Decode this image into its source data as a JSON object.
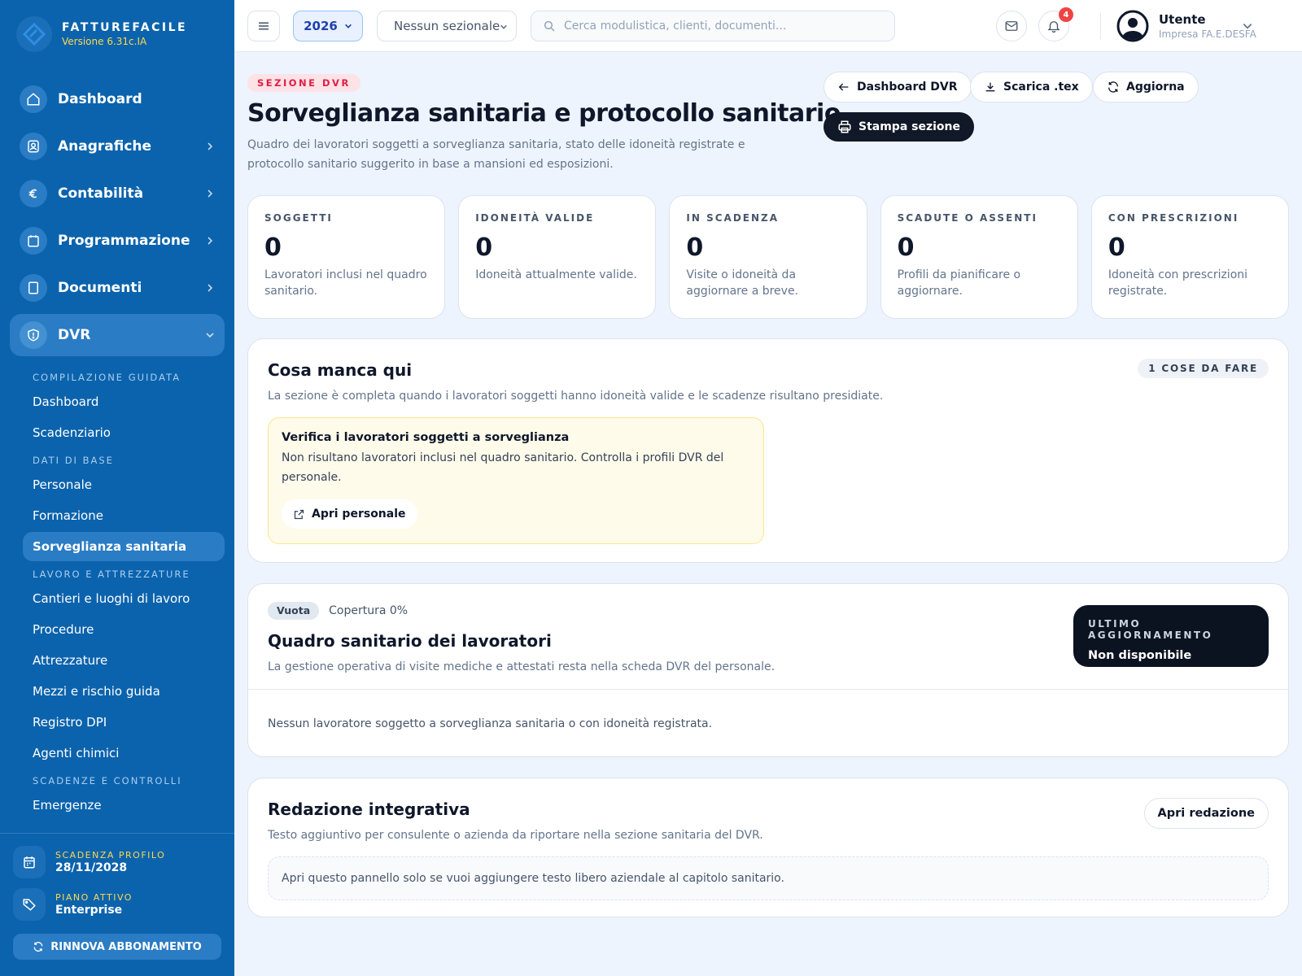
{
  "brand": {
    "name": "FATTUREFACILE",
    "version": "Versione 6.31c.IA"
  },
  "nav": [
    {
      "label": "Dashboard",
      "icon": "home-icon",
      "chevron": ""
    },
    {
      "label": "Anagrafiche",
      "icon": "contacts-icon",
      "chevron": "right"
    },
    {
      "label": "Contabilità",
      "icon": "euro-icon",
      "chevron": "right"
    },
    {
      "label": "Programmazione",
      "icon": "calendar-icon",
      "chevron": "right"
    },
    {
      "label": "Documenti",
      "icon": "document-icon",
      "chevron": "right"
    },
    {
      "label": "DVR",
      "icon": "shield-icon",
      "chevron": "down"
    }
  ],
  "subnav": {
    "sections": [
      {
        "title": "COMPILAZIONE GUIDATA",
        "items": [
          "Dashboard",
          "Scadenziario"
        ]
      },
      {
        "title": "DATI DI BASE",
        "items": [
          "Personale",
          "Formazione",
          "Sorveglianza sanitaria"
        ]
      },
      {
        "title": "LAVORO E ATTREZZATURE",
        "items": [
          "Cantieri e luoghi di lavoro",
          "Procedure",
          "Attrezzature",
          "Mezzi e rischio guida",
          "Registro DPI",
          "Agenti chimici"
        ]
      },
      {
        "title": "SCADENZE E CONTROLLI",
        "items": [
          "Emergenze"
        ]
      }
    ],
    "active": "Sorveglianza sanitaria"
  },
  "footer": {
    "expiry_label": "SCADENZA PROFILO",
    "expiry_value": "28/11/2028",
    "plan_label": "PIANO ATTIVO",
    "plan_value": "Enterprise",
    "renew_label": "RINNOVA ABBONAMENTO"
  },
  "topbar": {
    "year": "2026",
    "sezionale": "Nessun sezionale",
    "search_placeholder": "Cerca modulistica, clienti, documenti...",
    "notifications_count": "4",
    "user_name": "Utente",
    "user_company": "Impresa FA.E.DESFA"
  },
  "header": {
    "tag": "SEZIONE DVR",
    "title": "Sorveglianza sanitaria e protocollo sanitario",
    "description": "Quadro dei lavoratori soggetti a sorveglianza sanitaria, stato delle idoneità registrate e protocollo sanitario suggerito in base a mansioni ed esposizioni.",
    "btn_dashboard": "Dashboard DVR",
    "btn_download": "Scarica .tex",
    "btn_refresh": "Aggiorna",
    "btn_print": "Stampa sezione"
  },
  "stats": [
    {
      "label": "SOGGETTI",
      "value": "0",
      "desc": "Lavoratori inclusi nel quadro sanitario."
    },
    {
      "label": "IDONEITÀ VALIDE",
      "value": "0",
      "desc": "Idoneità attualmente valide."
    },
    {
      "label": "IN SCADENZA",
      "value": "0",
      "desc": "Visite o idoneità da aggiornare a breve."
    },
    {
      "label": "SCADUTE O ASSENTI",
      "value": "0",
      "desc": "Profili da pianificare o aggiornare."
    },
    {
      "label": "CON PRESCRIZIONI",
      "value": "0",
      "desc": "Idoneità con prescrizioni registrate."
    }
  ],
  "missing": {
    "title": "Cosa manca qui",
    "subtitle": "La sezione è completa quando i lavoratori soggetti hanno idoneità valide e le scadenze risultano presidiate.",
    "todo_chip": "1 COSE DA FARE",
    "warn_title": "Verifica i lavoratori soggetti a sorveglianza",
    "warn_text": "Non risultano lavoratori inclusi nel quadro sanitario. Controlla i profili DVR del personale.",
    "warn_button": "Apri personale"
  },
  "quadro": {
    "status_chip": "Vuota",
    "coverage": "Copertura 0%",
    "title": "Quadro sanitario dei lavoratori",
    "subtitle": "La gestione operativa di visite mediche e attestati resta nella scheda DVR del personale.",
    "last_update_label": "ULTIMO AGGIORNAMENTO",
    "last_update_value": "Non disponibile",
    "empty_text": "Nessun lavoratore soggetto a sorveglianza sanitaria o con idoneità registrata."
  },
  "redazione": {
    "title": "Redazione integrativa",
    "subtitle": "Testo aggiuntivo per consulente o azienda da riportare nella sezione sanitaria del DVR.",
    "button": "Apri redazione",
    "placeholder_text": "Apri questo pannello solo se vuoi aggiungere testo libero aziendale al capitolo sanitario."
  },
  "colors": {
    "sidebar": "#0b63ad",
    "accent_yellow": "#ffd84d",
    "tag_red": "#e11d48",
    "dark": "#111827"
  }
}
